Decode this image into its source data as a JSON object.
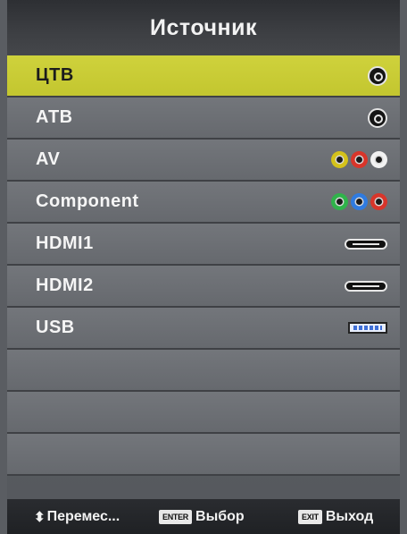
{
  "title": "Источник",
  "sources": [
    {
      "label": "ЦТВ",
      "icon": "antenna-icon",
      "selected": true
    },
    {
      "label": "АТВ",
      "icon": "antenna-icon",
      "selected": false
    },
    {
      "label": "AV",
      "icon": "av-jacks-icon",
      "selected": false
    },
    {
      "label": "Component",
      "icon": "component-jacks-icon",
      "selected": false
    },
    {
      "label": "HDMI1",
      "icon": "hdmi-port-icon",
      "selected": false
    },
    {
      "label": "HDMI2",
      "icon": "hdmi-port-icon",
      "selected": false
    },
    {
      "label": "USB",
      "icon": "usb-port-icon",
      "selected": false
    },
    {
      "label": "",
      "icon": "",
      "selected": false
    },
    {
      "label": "",
      "icon": "",
      "selected": false
    },
    {
      "label": "",
      "icon": "",
      "selected": false
    },
    {
      "label": "",
      "icon": "",
      "selected": false
    }
  ],
  "footer": {
    "move_arrows": "⬍",
    "move_label": "Перемес...",
    "enter_key": "ENTER",
    "select_label": "Выбор",
    "exit_key": "EXIT",
    "exit_label": "Выход"
  },
  "colors": {
    "selected_highlight": "#c9cc35",
    "av_jacks": [
      "#d4c21a",
      "#d8352a",
      "#f2f2f2"
    ],
    "component_jacks": [
      "#2fb34a",
      "#2f7be0",
      "#d8352a"
    ]
  }
}
